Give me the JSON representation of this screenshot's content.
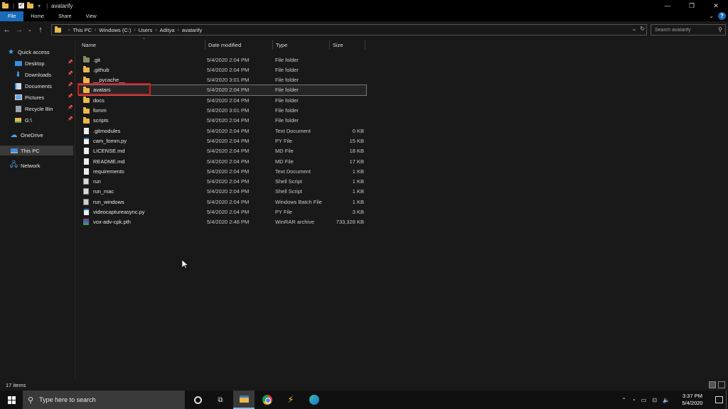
{
  "window": {
    "title": "avatarify",
    "controls": [
      "—",
      "❐",
      "✕"
    ]
  },
  "ribbon": {
    "tabs": [
      "File",
      "Home",
      "Share",
      "View"
    ],
    "help": "?"
  },
  "address": {
    "crumbs": [
      "This PC",
      "Windows (C:)",
      "Users",
      "Aditya",
      "avatarify"
    ],
    "search_placeholder": "Search avatarify"
  },
  "nav_pane": {
    "items": [
      {
        "label": "Quick access",
        "icon": "star-icon",
        "pinned": false
      },
      {
        "label": "Desktop",
        "icon": "desktop-icon",
        "pinned": true
      },
      {
        "label": "Downloads",
        "icon": "download-icon",
        "pinned": true
      },
      {
        "label": "Documents",
        "icon": "documents-icon",
        "pinned": true
      },
      {
        "label": "Pictures",
        "icon": "pictures-icon",
        "pinned": true
      },
      {
        "label": "Recycle Bin",
        "icon": "recycle-bin-icon",
        "pinned": true
      },
      {
        "label": "G:\\",
        "icon": "drive-icon",
        "pinned": true
      },
      {
        "label": "OneDrive",
        "icon": "cloud-icon",
        "pinned": false
      },
      {
        "label": "This PC",
        "icon": "computer-icon",
        "pinned": false
      },
      {
        "label": "Network",
        "icon": "network-icon",
        "pinned": false
      }
    ]
  },
  "columns": {
    "name": "Name",
    "date": "Date modified",
    "type": "Type",
    "size": "Size"
  },
  "files": [
    {
      "name": ".git",
      "date": "5/4/2020 2:04 PM",
      "type": "File folder",
      "size": "",
      "icon": "folder-git"
    },
    {
      "name": ".github",
      "date": "5/4/2020 2:04 PM",
      "type": "File folder",
      "size": "",
      "icon": "folder"
    },
    {
      "name": "__pycache__",
      "date": "5/4/2020 3:01 PM",
      "type": "File folder",
      "size": "",
      "icon": "folder"
    },
    {
      "name": "avatars",
      "date": "5/4/2020 2:04 PM",
      "type": "File folder",
      "size": "",
      "icon": "folder"
    },
    {
      "name": "docs",
      "date": "5/4/2020 2:04 PM",
      "type": "File folder",
      "size": "",
      "icon": "folder"
    },
    {
      "name": "fomm",
      "date": "5/4/2020 3:01 PM",
      "type": "File folder",
      "size": "",
      "icon": "folder"
    },
    {
      "name": "scripts",
      "date": "5/4/2020 2:04 PM",
      "type": "File folder",
      "size": "",
      "icon": "folder"
    },
    {
      "name": ".gitmodules",
      "date": "5/4/2020 2:04 PM",
      "type": "Text Document",
      "size": "0 KB",
      "icon": "doc"
    },
    {
      "name": "cam_fomm.py",
      "date": "5/4/2020 2:04 PM",
      "type": "PY File",
      "size": "15 KB",
      "icon": "py"
    },
    {
      "name": "LICENSE.md",
      "date": "5/4/2020 2:04 PM",
      "type": "MD File",
      "size": "18 KB",
      "icon": "doc"
    },
    {
      "name": "README.md",
      "date": "5/4/2020 2:04 PM",
      "type": "MD File",
      "size": "17 KB",
      "icon": "doc"
    },
    {
      "name": "requirements",
      "date": "5/4/2020 2:04 PM",
      "type": "Text Document",
      "size": "1 KB",
      "icon": "doc"
    },
    {
      "name": "run",
      "date": "5/4/2020 2:04 PM",
      "type": "Shell Script",
      "size": "1 KB",
      "icon": "sh"
    },
    {
      "name": "run_mac",
      "date": "5/4/2020 2:04 PM",
      "type": "Shell Script",
      "size": "1 KB",
      "icon": "sh"
    },
    {
      "name": "run_windows",
      "date": "5/4/2020 2:04 PM",
      "type": "Windows Batch File",
      "size": "1 KB",
      "icon": "bat"
    },
    {
      "name": "videocaptureasync.py",
      "date": "5/4/2020 2:04 PM",
      "type": "PY File",
      "size": "3 KB",
      "icon": "py"
    },
    {
      "name": "vox-adv-cpk.pth",
      "date": "5/4/2020 2:46 PM",
      "type": "WinRAR archive",
      "size": "733,328 KB",
      "icon": "rar"
    }
  ],
  "selected_file": "avatars",
  "status": {
    "item_count": "17 items"
  },
  "taskbar": {
    "search_placeholder": "Type here to search",
    "time": "3:37 PM",
    "date": "5/4/2020"
  },
  "colors": {
    "accent": "#1a6bb8",
    "folder": "#e8b94b",
    "highlight": "#e0141c",
    "background": "#191919"
  }
}
